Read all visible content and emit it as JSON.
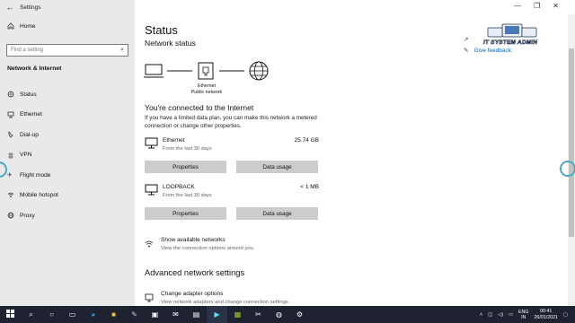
{
  "window": {
    "title": "Settings"
  },
  "nav": {
    "home_label": "Home",
    "search_placeholder": "Find a setting",
    "section_title": "Network & Internet",
    "items": [
      {
        "label": "Status",
        "icon": "home-globe-icon"
      },
      {
        "label": "Ethernet",
        "icon": "ethernet-icon"
      },
      {
        "label": "Dial-up",
        "icon": "dial-up-icon"
      },
      {
        "label": "VPN",
        "icon": "vpn-icon"
      },
      {
        "label": "Flight mode",
        "icon": "airplane-icon"
      },
      {
        "label": "Mobile hotspot",
        "icon": "hotspot-icon"
      },
      {
        "label": "Proxy",
        "icon": "globe-icon"
      }
    ]
  },
  "main": {
    "title": "Status",
    "subtitle": "Network status",
    "diagram": {
      "adapter_name": "Ethernet",
      "network_type": "Public network"
    },
    "side_links": {
      "feedback": "Give feedback"
    },
    "connected_text": "You're connected to the Internet",
    "metered_text": "If you have a limited data plan, you can make this network a metered connection or change other properties.",
    "networks": [
      {
        "name": "Ethernet",
        "period": "From the last 30 days",
        "usage": "25.74 GB",
        "properties_label": "Properties",
        "data_usage_label": "Data usage"
      },
      {
        "name": "LOOPBACK",
        "period": "From the last 30 days",
        "usage": "< 1 MB",
        "properties_label": "Properties",
        "data_usage_label": "Data usage"
      }
    ],
    "show_networks": {
      "title": "Show available networks",
      "subtitle": "View the connection options around you."
    },
    "advanced_title": "Advanced network settings",
    "adapter": {
      "title": "Change adapter options",
      "subtitle": "View network adapters and change connection settings."
    }
  },
  "watermark": {
    "text": "IT SYSTEM ADMIN"
  },
  "taskbar": {
    "lang_top": "ENG",
    "lang_bottom": "IN",
    "time": "00:41",
    "date": "26/01/2021"
  }
}
